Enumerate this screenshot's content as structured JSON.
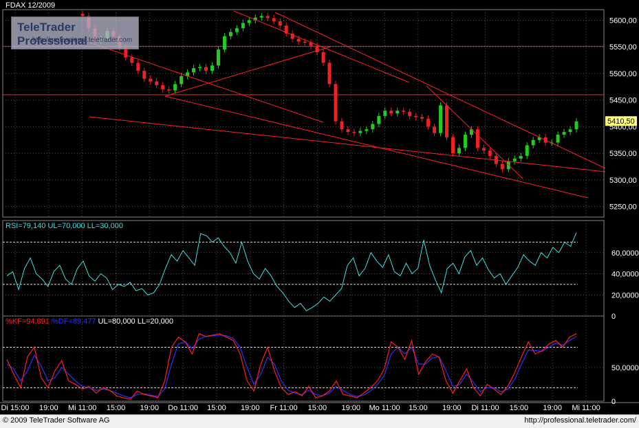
{
  "header": {
    "title": "FDAX 12/2009"
  },
  "watermark": {
    "brand": "TeleTrader Professional",
    "url": "http://professional.teletrader.com"
  },
  "footer": {
    "copyright": "© 2009 TeleTrader Software AG",
    "url": "http://professional.teletrader.com/"
  },
  "colors": {
    "up": "#22cc22",
    "down": "#ee2222",
    "trend": "#ff2020",
    "rsi": "#40e0e0",
    "kf": "#ff2020",
    "df": "#3030ff",
    "grid": "#555",
    "bg": "#000"
  },
  "chart_data": {
    "type": "candlestick",
    "price_panel": {
      "ylim": [
        5230,
        5620
      ],
      "y_ticks": [
        "5600,00",
        "5550,00",
        "5500,00",
        "5450,00",
        "5400,00",
        "5350,00",
        "5300,00",
        "5250,00"
      ],
      "last_price": "5410,50",
      "horizontal_levels": [
        5551,
        5460
      ],
      "close": [
        5608,
        5585,
        5560,
        5565,
        5580,
        5570,
        5548,
        5530,
        5520,
        5505,
        5490,
        5485,
        5478,
        5470,
        5468,
        5480,
        5495,
        5502,
        5510,
        5512,
        5505,
        5515,
        5545,
        5570,
        5578,
        5585,
        5595,
        5600,
        5605,
        5608,
        5604,
        5598,
        5590,
        5575,
        5565,
        5560,
        5558,
        5552,
        5540,
        5520,
        5480,
        5410,
        5395,
        5390,
        5388,
        5392,
        5395,
        5405,
        5420,
        5430,
        5425,
        5430,
        5428,
        5420,
        5418,
        5415,
        5400,
        5388,
        5440,
        5380,
        5350,
        5360,
        5385,
        5395,
        5360,
        5355,
        5345,
        5330,
        5320,
        5335,
        5340,
        5345,
        5365,
        5375,
        5380,
        5370,
        5370,
        5385,
        5390,
        5395,
        5410
      ]
    },
    "rsi_panel": {
      "label": "RSI=79,140 UL=70,000 LL=30,000",
      "ylim": [
        0,
        80
      ],
      "y_ticks": [
        "60,0000",
        "40,0000",
        "20,0000",
        "0"
      ],
      "levels": [
        70,
        30
      ],
      "values": [
        38,
        42,
        25,
        45,
        55,
        40,
        35,
        28,
        42,
        48,
        35,
        30,
        45,
        52,
        38,
        33,
        40,
        36,
        25,
        30,
        28,
        32,
        24,
        26,
        20,
        22,
        30,
        45,
        58,
        52,
        62,
        55,
        48,
        78,
        76,
        70,
        74,
        66,
        60,
        50,
        70,
        52,
        40,
        35,
        45,
        38,
        28,
        22,
        14,
        8,
        12,
        5,
        8,
        12,
        18,
        14,
        20,
        26,
        48,
        55,
        38,
        45,
        60,
        52,
        46,
        58,
        42,
        38,
        50,
        40,
        45,
        72,
        48,
        34,
        22,
        45,
        50,
        40,
        56,
        62,
        48,
        55,
        44,
        36,
        40,
        30,
        38,
        46,
        58,
        52,
        48,
        60,
        55,
        65,
        60,
        70,
        66,
        79
      ]
    },
    "stoch_panel": {
      "label_kf": "%KF=94,891",
      "label_df": "%DF=89,477",
      "label_rest": "UL=80,000 LL=20,000",
      "ylim": [
        0,
        110
      ],
      "y_ticks": [
        "50,0000",
        "0"
      ],
      "levels": [
        80,
        20
      ],
      "kf": [
        62,
        40,
        20,
        66,
        80,
        35,
        20,
        45,
        60,
        30,
        25,
        18,
        22,
        12,
        20,
        16,
        8,
        5,
        3,
        15,
        10,
        8,
        5,
        30,
        80,
        95,
        88,
        70,
        100,
        96,
        98,
        100,
        95,
        90,
        70,
        30,
        15,
        55,
        80,
        45,
        20,
        10,
        14,
        8,
        22,
        5,
        8,
        15,
        30,
        10,
        8,
        5,
        12,
        20,
        30,
        48,
        88,
        80,
        62,
        90,
        40,
        58,
        70,
        65,
        30,
        12,
        30,
        48,
        20,
        8,
        25,
        18,
        10,
        22,
        42,
        66,
        88,
        70,
        75,
        85,
        90,
        80,
        95,
        100
      ],
      "df": [
        55,
        48,
        30,
        45,
        68,
        52,
        30,
        35,
        50,
        40,
        30,
        22,
        20,
        16,
        18,
        16,
        12,
        8,
        5,
        10,
        11,
        9,
        7,
        18,
        55,
        85,
        88,
        78,
        92,
        96,
        97,
        98,
        97,
        93,
        80,
        50,
        25,
        40,
        65,
        55,
        30,
        16,
        12,
        10,
        16,
        10,
        8,
        12,
        22,
        16,
        10,
        7,
        9,
        15,
        25,
        38,
        70,
        80,
        70,
        80,
        55,
        55,
        64,
        66,
        45,
        22,
        25,
        40,
        28,
        14,
        20,
        20,
        14,
        18,
        32,
        55,
        76,
        75,
        74,
        80,
        86,
        83,
        90,
        96
      ]
    },
    "x_ticks": [
      "Di 15:00",
      "19:00",
      "Mi 11:00",
      "15:00",
      "19:00",
      "Do 11:00",
      "15:00",
      "19:00",
      "Fr 11:00",
      "15:00",
      "19:00",
      "Mo 11:00",
      "15:00",
      "19:00",
      "Di 11:00",
      "15:00",
      "19:00",
      "Mi 11:00"
    ]
  }
}
